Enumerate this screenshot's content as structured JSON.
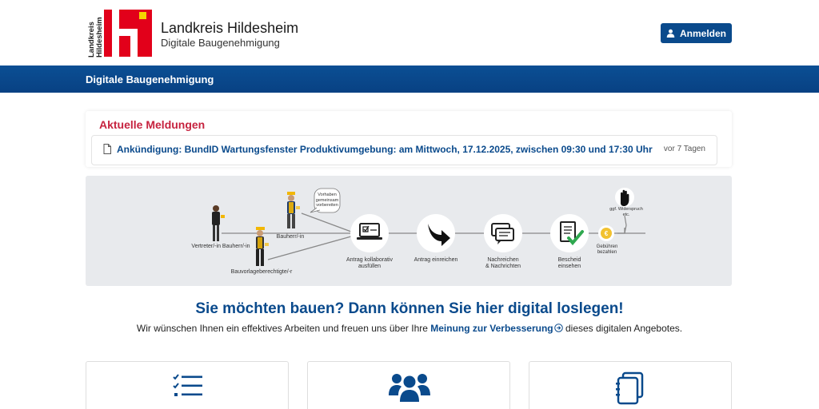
{
  "header": {
    "logo_text_line1": "Landkreis",
    "logo_text_line2": "Hildesheim",
    "title": "Landkreis Hildesheim",
    "subtitle": "Digitale Baugenehmigung",
    "login_label": "Anmelden"
  },
  "nav": {
    "title": "Digitale Baugenehmigung"
  },
  "news": {
    "heading": "Aktuelle Meldungen",
    "items": [
      {
        "text": "Ankündigung: BundID Wartungsfenster Produktivumgebung: am Mittwoch, 17.12.2025, zwischen 09:30 und 17:30 Uhr",
        "age": "vor 7 Tagen"
      }
    ]
  },
  "process": {
    "role_vertreter": "Vertreter/-in Bauherr/-in",
    "role_bauherr": "Bauherr/-in",
    "role_bauvorlage": "Bauvorlageberechtigte/-r",
    "bubble_line1": "Vorhaben",
    "bubble_line2": "gemeinsam",
    "bubble_line3": "vorbereiten",
    "step1_line1": "Antrag kollaborativ",
    "step1_line2": "ausfüllen",
    "step2": "Antrag einreichen",
    "step3_line1": "Nachreichen",
    "step3_line2": "& Nachrichten",
    "step4_line1": "Bescheid",
    "step4_line2": "einsehen",
    "fee_line1": "Gebühren",
    "fee_line2": "bezahlen",
    "objection_line1": "ggf. Widerspruch",
    "objection_line2": "etc."
  },
  "intro": {
    "headline": "Sie möchten bauen? Dann können Sie hier digital loslegen!",
    "text_before": "Wir wünschen Ihnen ein effektives Arbeiten und freuen uns über Ihre",
    "link": "Meinung zur Verbesserung",
    "text_after": "dieses digitalen Angebotes."
  },
  "colors": {
    "brand_blue": "#0a4a8c",
    "logo_red": "#e2001a",
    "news_red": "#c6233f"
  },
  "cards": [
    {
      "icon": "checklist-icon"
    },
    {
      "icon": "users-group-icon"
    },
    {
      "icon": "documents-icon"
    }
  ]
}
